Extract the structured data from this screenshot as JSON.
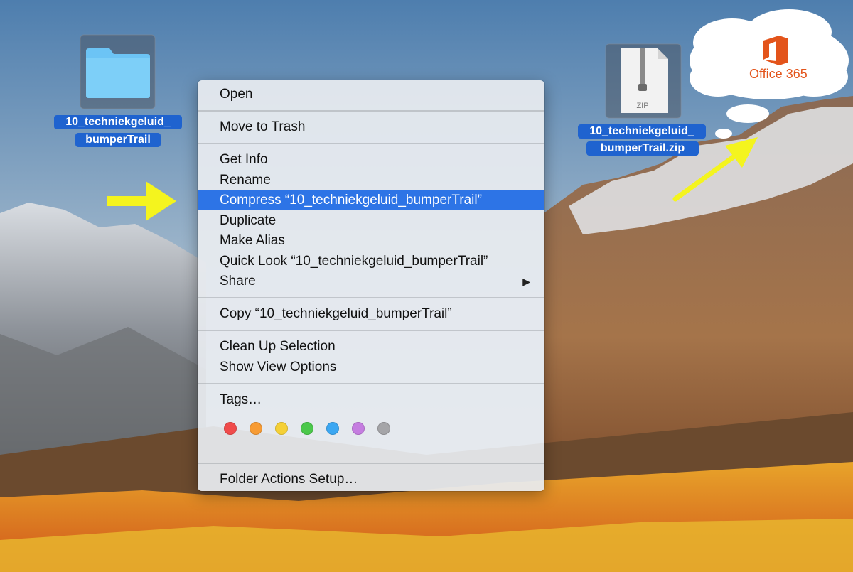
{
  "desktop": {
    "folder_icon": {
      "label_line1": "10_techniekgeluid_",
      "label_line2": "bumperTrail"
    },
    "zip_icon": {
      "badge": "ZIP",
      "label_line1": "10_techniekgeluid_",
      "label_line2": "bumperTrail.zip"
    }
  },
  "context_menu": {
    "items": [
      {
        "label": "Open"
      },
      {
        "label": "Move to Trash"
      },
      {
        "label": "Get Info"
      },
      {
        "label": "Rename"
      },
      {
        "label": "Compress “10_techniekgeluid_bumperTrail”"
      },
      {
        "label": "Duplicate"
      },
      {
        "label": "Make Alias"
      },
      {
        "label": "Quick Look “10_techniekgeluid_bumperTrail”"
      },
      {
        "label": "Share"
      },
      {
        "label": "Copy “10_techniekgeluid_bumperTrail”"
      },
      {
        "label": "Clean Up Selection"
      },
      {
        "label": "Show View Options"
      },
      {
        "label": "Tags…"
      },
      {
        "label": "Folder Actions Setup…"
      }
    ],
    "highlighted_item": "Compress “10_techniekgeluid_bumperTrail”",
    "submenu_arrow": "▶",
    "tag_colors": [
      {
        "name": "red",
        "color": "#f04b4b"
      },
      {
        "name": "orange",
        "color": "#f79b33"
      },
      {
        "name": "yellow",
        "color": "#f5d036"
      },
      {
        "name": "green",
        "color": "#4bc84b"
      },
      {
        "name": "blue",
        "color": "#3ba7f2"
      },
      {
        "name": "purple",
        "color": "#c57de0"
      },
      {
        "name": "gray",
        "color": "#a5a5a8"
      }
    ],
    "highlight_color": "#2d74e6"
  },
  "annotations": {
    "arrow_color": "#f4f41e",
    "office_logo_text": "Office 365",
    "office_brand_color": "#e3541b"
  }
}
